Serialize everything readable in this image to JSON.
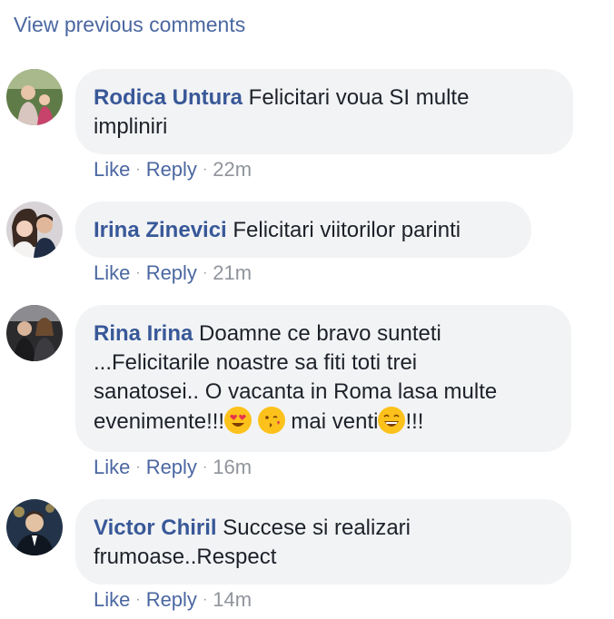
{
  "view_previous": "View previous comments",
  "comments": [
    {
      "author": "Rodica Untura",
      "text_line1": " Felicitari voua SI multe",
      "text_line2": "impliniri",
      "like": "Like",
      "reply": "Reply",
      "time": "22m"
    },
    {
      "author": "Irina Zinevici",
      "text_line1": " Felicitari viitorilor parinti",
      "like": "Like",
      "reply": "Reply",
      "time": "21m"
    },
    {
      "author": "Rina Irina",
      "text_line1": " Doamne ce bravo sunteti",
      "text_line2": "...Felicitarile noastre sa fiti toti trei",
      "text_line3": "sanatosei.. O vacanta in Roma lasa multe",
      "text_line4a": "evenimente!!!",
      "text_line4b": " mai venti",
      "text_line4c": "!!!",
      "like": "Like",
      "reply": "Reply",
      "time": "16m"
    },
    {
      "author": "Victor Chiril",
      "text_line1": " Succese si realizari",
      "text_line2": "frumoase..Respect",
      "like": "Like",
      "reply": "Reply",
      "time": "14m"
    }
  ],
  "separator": "·",
  "icons": [
    "heart-eyes-emoji",
    "kissing-emoji",
    "grinning-emoji"
  ]
}
